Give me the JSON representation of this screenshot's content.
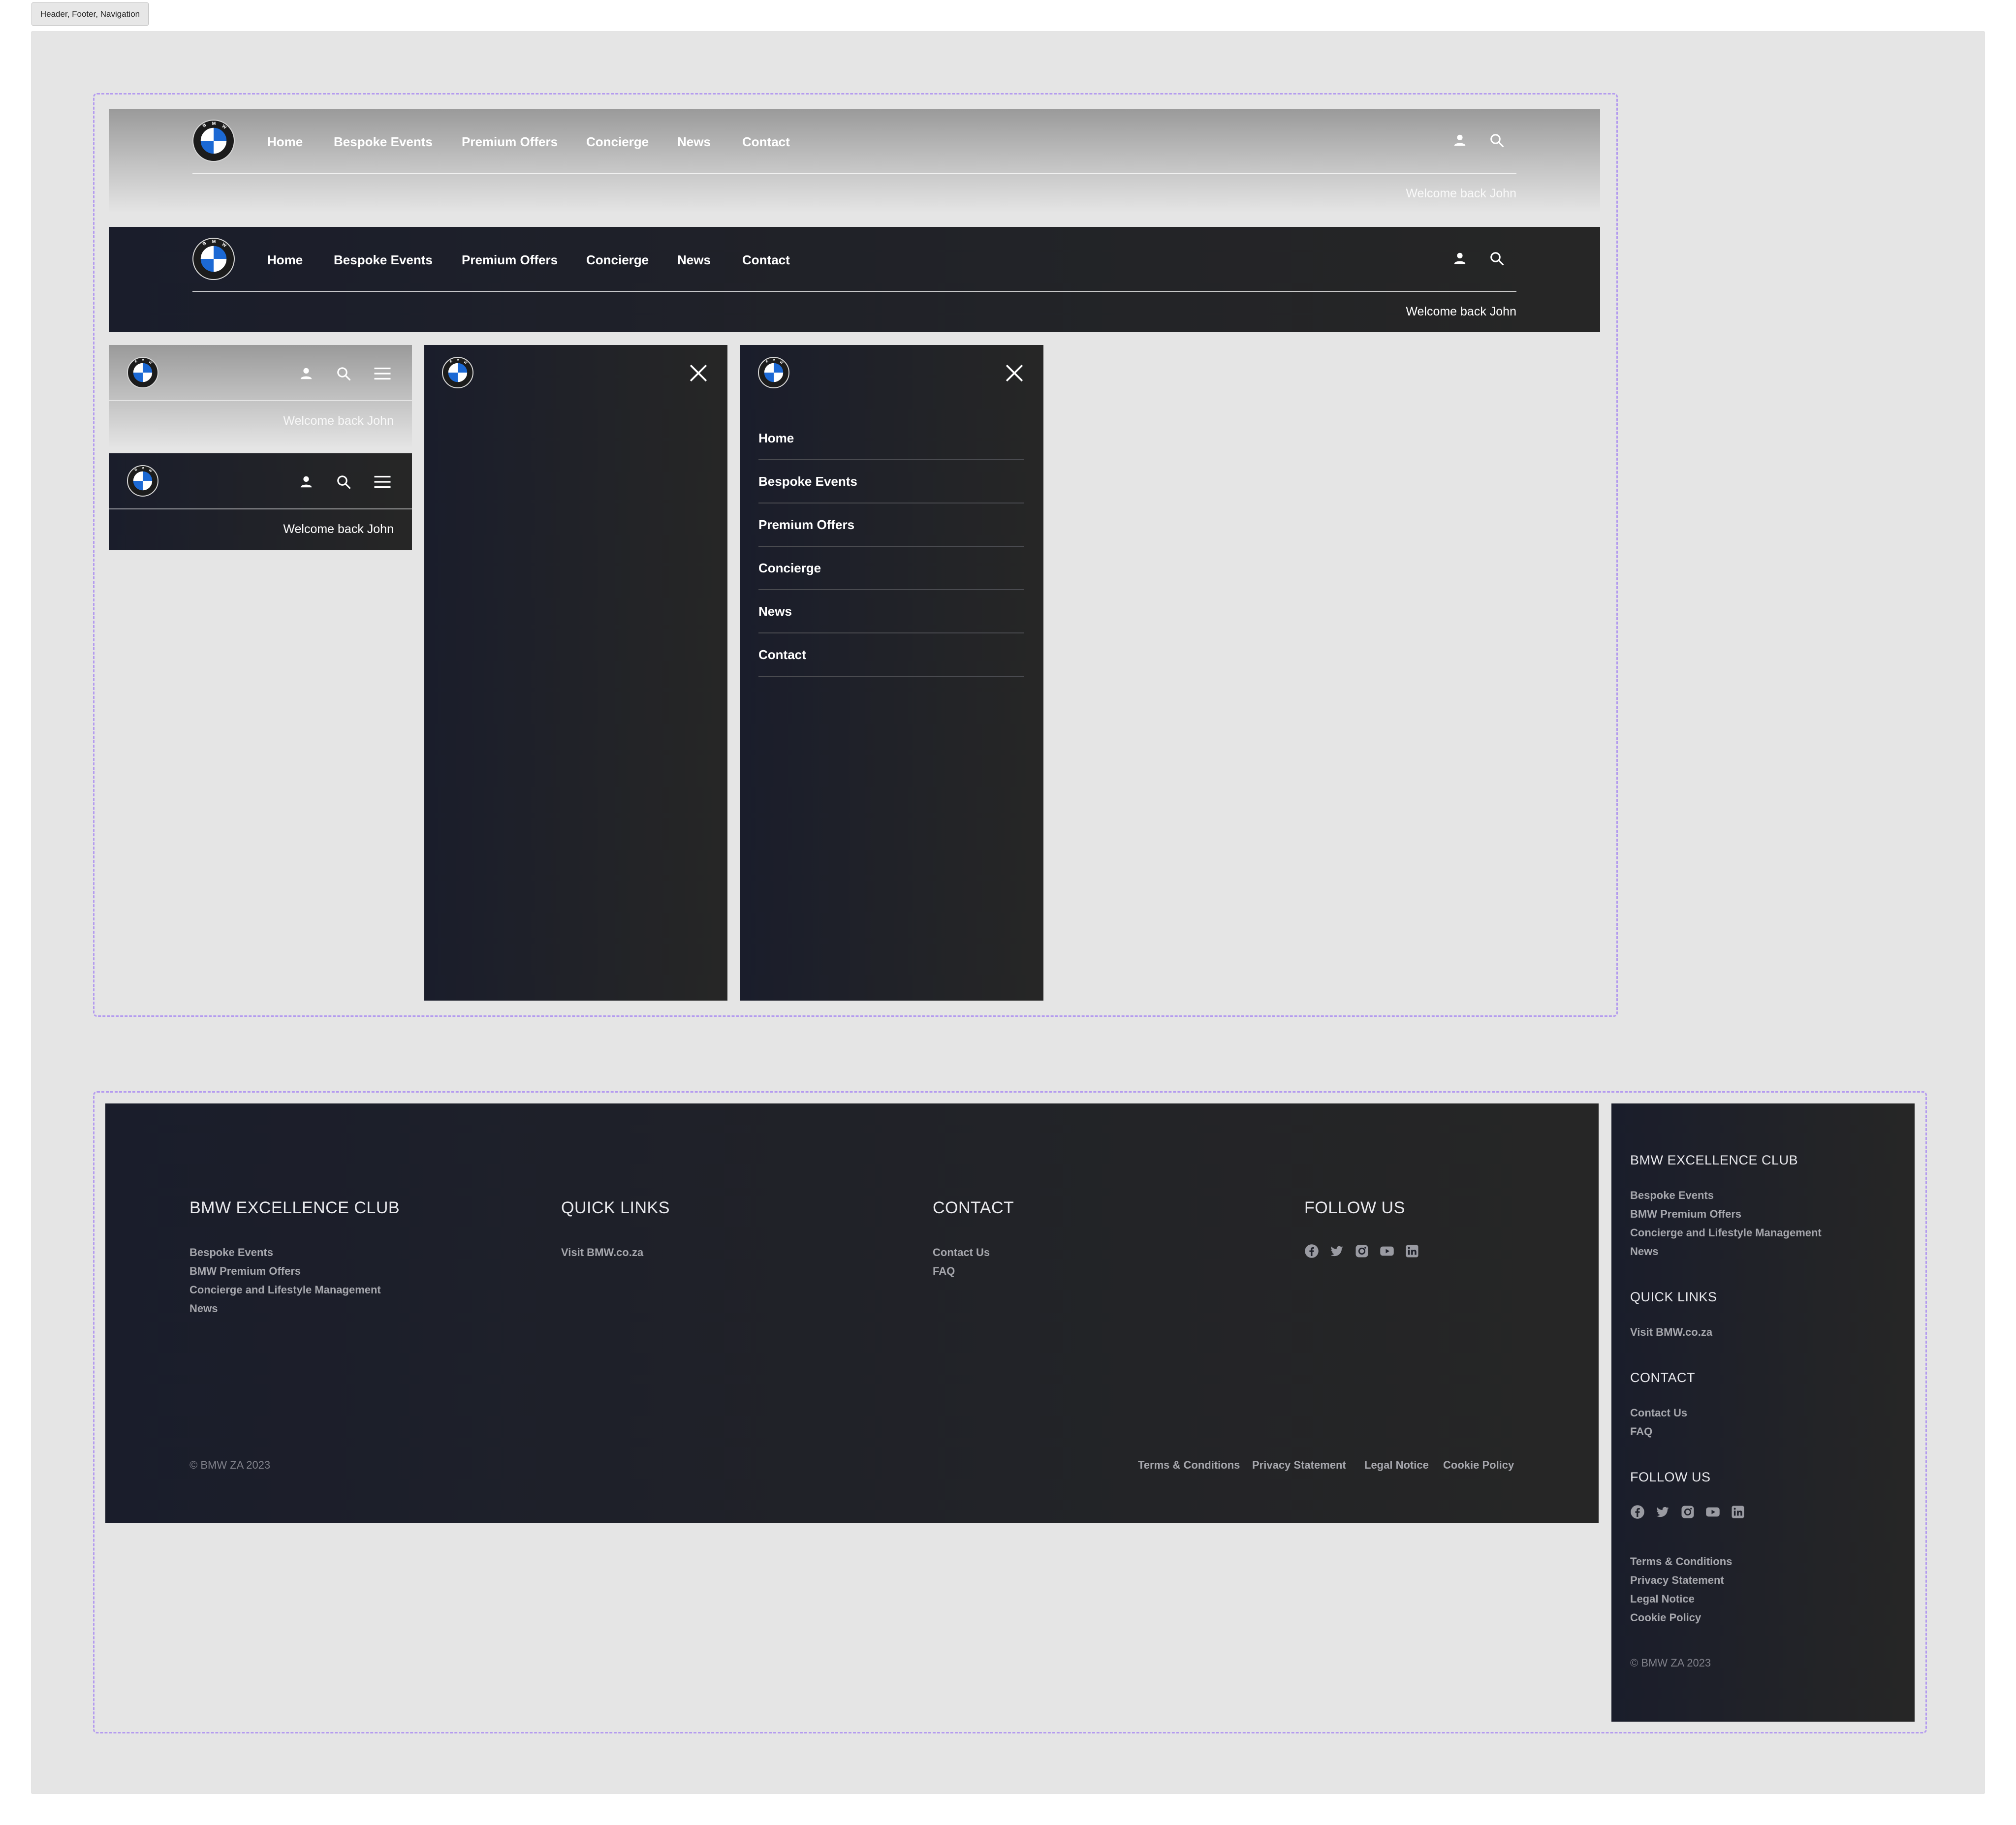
{
  "frame_label": "Header, Footer, Navigation",
  "nav": {
    "items": [
      "Home",
      "Bespoke Events",
      "Premium Offers",
      "Concierge",
      "News",
      "Contact"
    ],
    "welcome": "Welcome back John"
  },
  "footer": {
    "club_title": "BMW EXCELLENCE CLUB",
    "club_links": [
      "Bespoke Events",
      "BMW Premium Offers",
      "Concierge and Lifestyle Management",
      "News"
    ],
    "quick_title": "QUICK LINKS",
    "quick_links": [
      "Visit BMW.co.za"
    ],
    "contact_title": "CONTACT",
    "contact_links": [
      "Contact Us",
      "FAQ"
    ],
    "follow_title": "FOLLOW US",
    "social_icons": [
      "facebook-icon",
      "twitter-icon",
      "instagram-icon",
      "youtube-icon",
      "linkedin-icon"
    ],
    "copyright": "© BMW ZA 2023",
    "legal_links": [
      "Terms & Conditions",
      "Privacy Statement",
      "Legal Notice",
      "Cookie Policy"
    ]
  },
  "colors": {
    "canvas": "#e5e5e5",
    "dark_bg": "#1e2029",
    "dashed_border": "#b49bef",
    "bmw_blue": "#1c69d4"
  }
}
